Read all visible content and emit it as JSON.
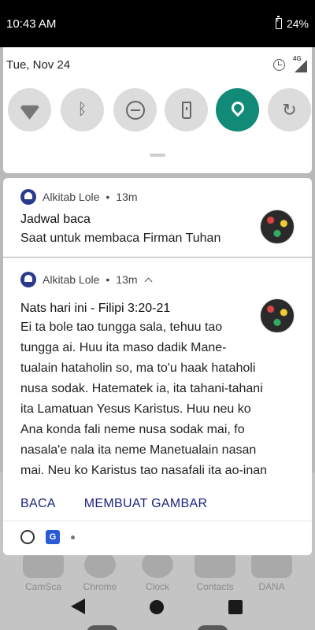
{
  "status_bar": {
    "time": "10:43 AM",
    "battery": "24%"
  },
  "quick_settings": {
    "date": "Tue, Nov 24",
    "network": "4G",
    "tiles": [
      {
        "name": "wifi",
        "active": false
      },
      {
        "name": "bluetooth",
        "active": false
      },
      {
        "name": "do-not-disturb",
        "active": false
      },
      {
        "name": "flashlight",
        "active": false
      },
      {
        "name": "location",
        "active": true
      },
      {
        "name": "auto-rotate",
        "active": false
      }
    ]
  },
  "notifications": [
    {
      "app": "Alkitab Lole",
      "time": "13m",
      "title": "Jadwal baca",
      "text": "Saat untuk membaca Firman Tuhan"
    },
    {
      "app": "Alkitab Lole",
      "time": "13m",
      "title": "Nats hari ini - Filipi 3:20-21",
      "lines": [
        "Ei ta bole tao tungga sala, tehuu tao",
        "tungga ai. Huu ita maso dadik Mane-",
        "tualain hataholin so, ma to'u haak hataholi",
        "nusa sodak. Hatematek ia, ita tahani-tahani",
        "ita Lamatuan Yesus Karistus. Huu neu ko",
        "Ana konda fali neme nusa sodak mai, fo",
        "nasala'e nala ita neme Manetualain nasan",
        "mai. Neu ko Karistus tao nasafali ita ao-inan"
      ],
      "actions": [
        "BACA",
        "MEMBUAT GAMBAR"
      ]
    }
  ],
  "home_apps": [
    "CamSca",
    "Chrome",
    "Clock",
    "Contacts",
    "DANA"
  ],
  "colors": {
    "accent_tile": "#128a78",
    "action_text": "#1a237e",
    "app_icon": "#2a3a8c"
  }
}
